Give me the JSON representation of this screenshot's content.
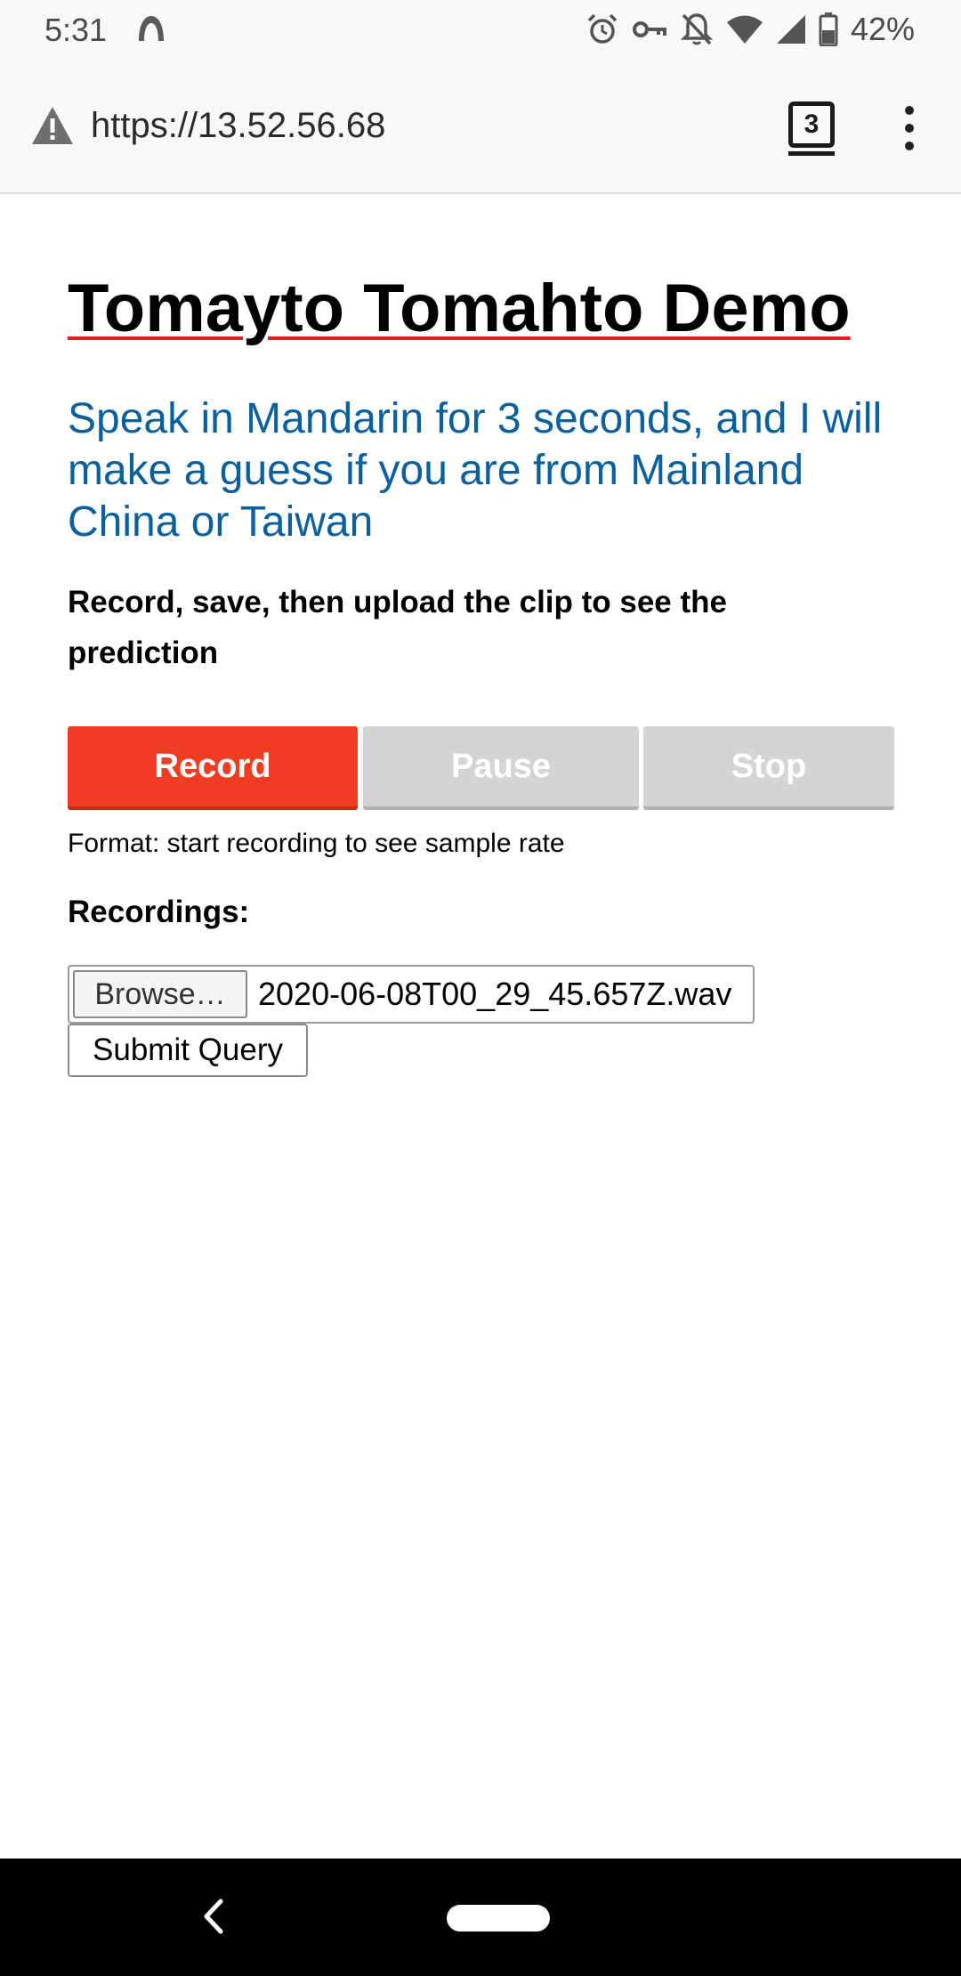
{
  "status_bar": {
    "time": "5:31",
    "battery": "42%",
    "icons": [
      "app-notification-icon",
      "alarm-icon",
      "vpn-key-icon",
      "notifications-off-icon",
      "wifi-icon",
      "cell-signal-icon",
      "battery-icon"
    ]
  },
  "browser": {
    "url": "https://13.52.56.68",
    "tab_count": "3",
    "security_icon": "warning-icon",
    "menu_icon": "more-vert-icon"
  },
  "page": {
    "title": "Tomayto Tomahto Demo",
    "subtitle": "Speak in Mandarin for 3 seconds, and I will make a guess if you are from Mainland China or Taiwan",
    "instructions": "Record, save, then upload the clip to see the prediction",
    "buttons": {
      "record": "Record",
      "pause": "Pause",
      "stop": "Stop"
    },
    "format_text": "Format: start recording to see sample rate",
    "recordings_label": "Recordings:",
    "file_input": {
      "browse_label": "Browse…",
      "file_name": "2020-06-08T00_29_45.657Z.wav"
    },
    "submit_label": "Submit Query"
  },
  "colors": {
    "title_underline": "#e02020",
    "subtitle": "#0a5f9e",
    "record_button": "#ef3c23",
    "disabled_button": "#d4d4d4"
  },
  "nav_bar": {
    "icons": [
      "back-icon",
      "home-pill-icon"
    ]
  }
}
